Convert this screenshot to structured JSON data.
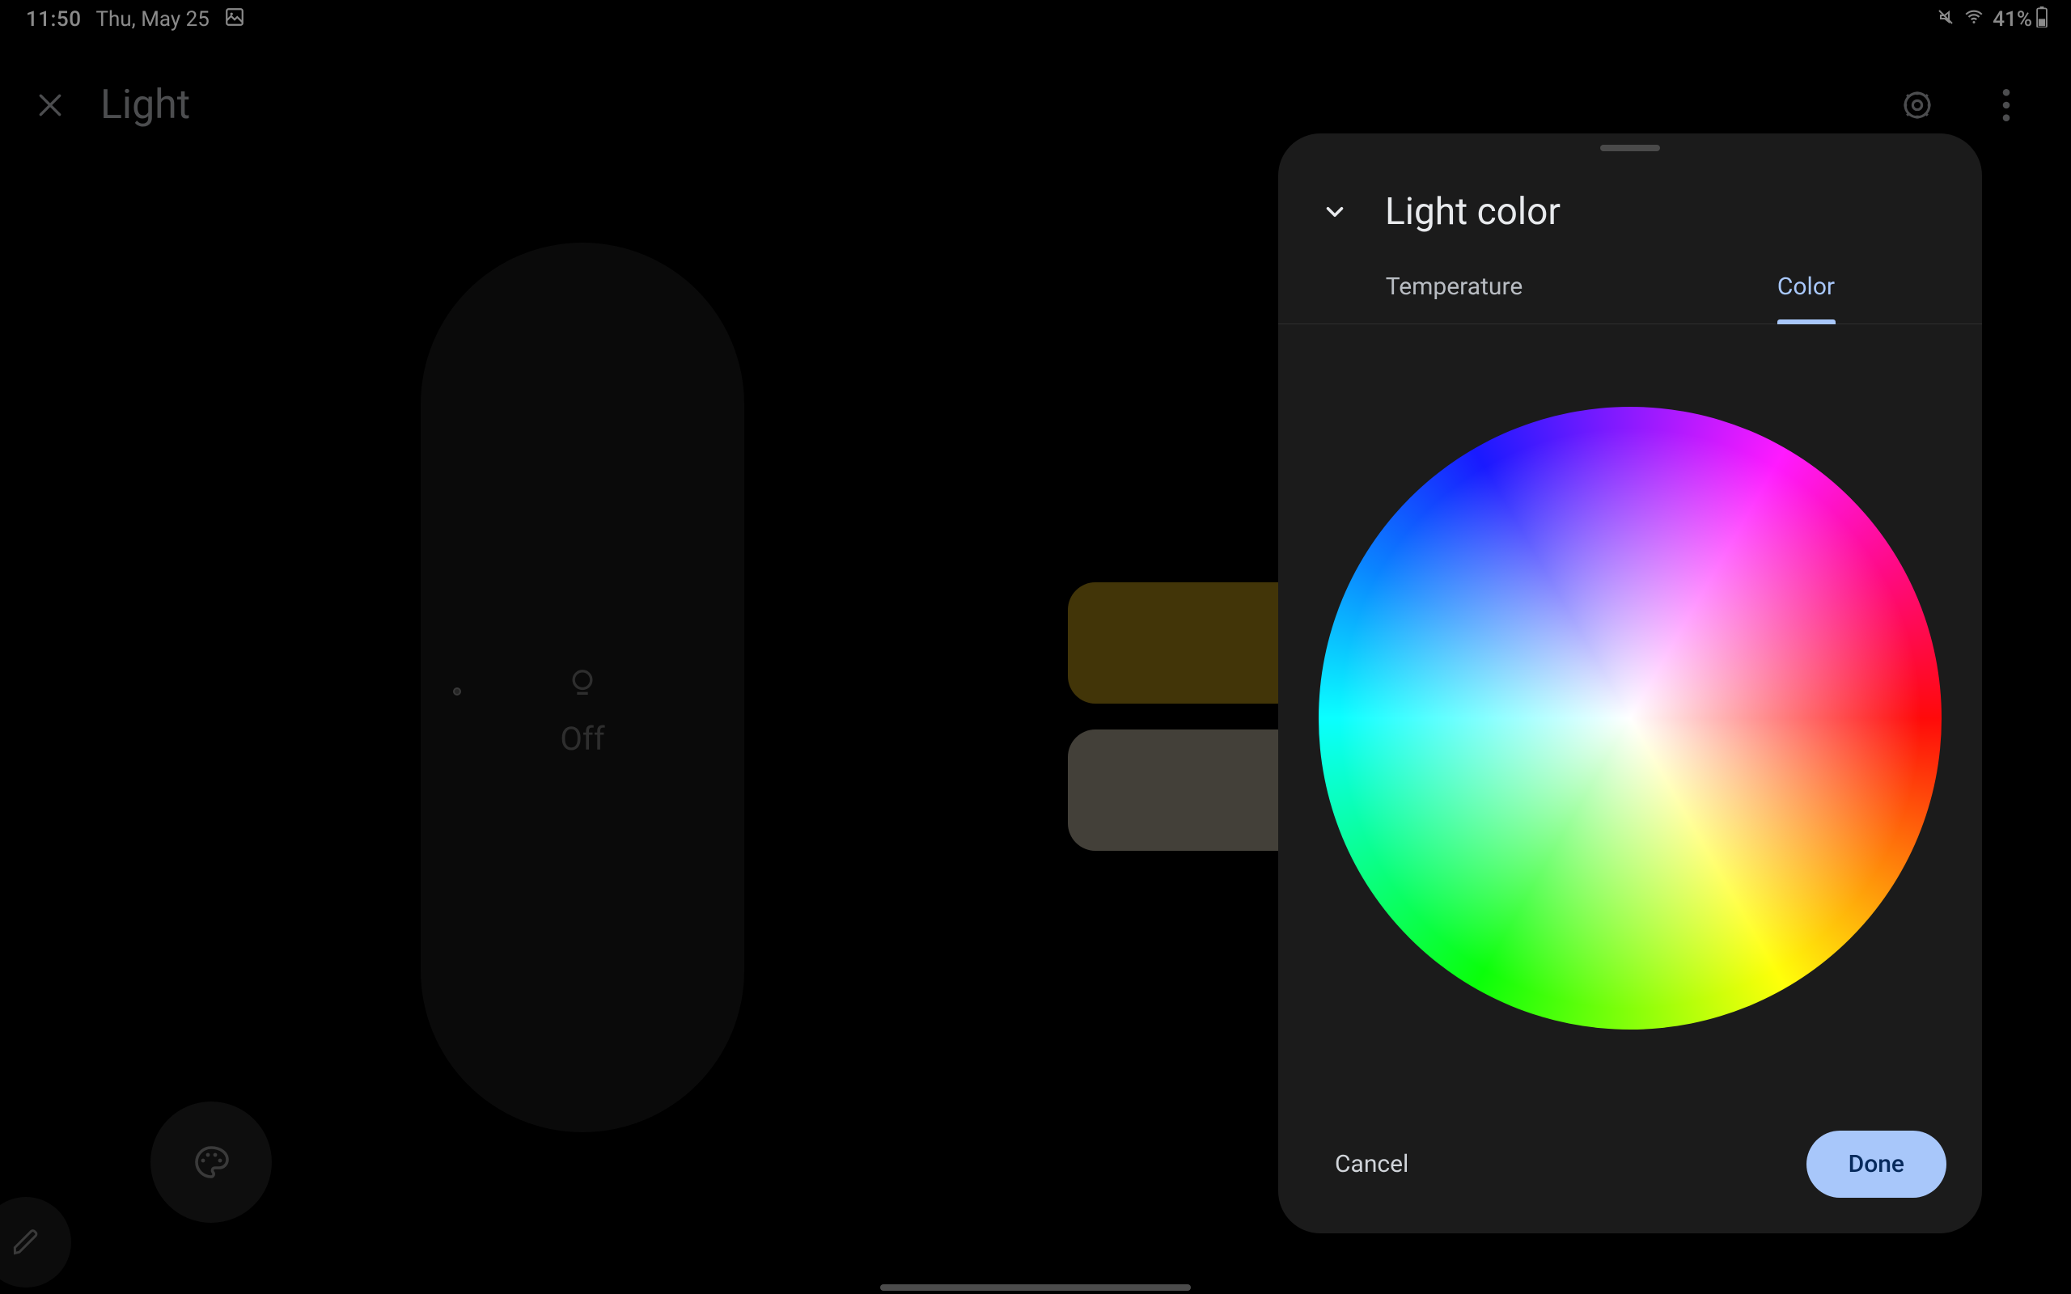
{
  "status": {
    "time": "11:50",
    "date": "Thu, May 25",
    "battery_text": "41%"
  },
  "app": {
    "title": "Light"
  },
  "slider": {
    "state_label": "Off"
  },
  "modal": {
    "title": "Light color",
    "tabs": {
      "temperature": "Temperature",
      "color": "Color"
    },
    "cancel": "Cancel",
    "done": "Done"
  }
}
